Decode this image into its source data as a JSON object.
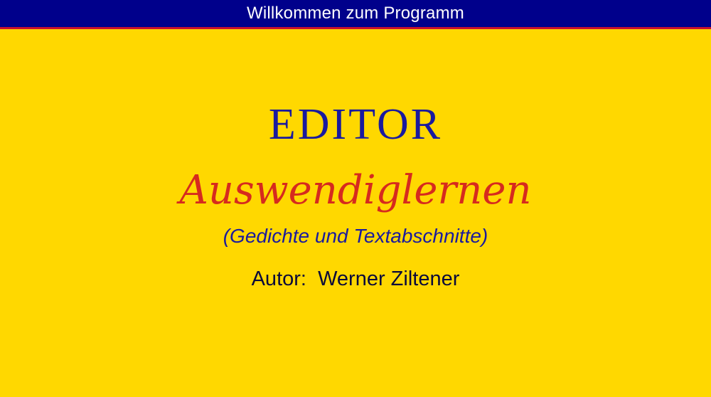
{
  "window": {
    "title": "Willkommen zum Programm"
  },
  "splash": {
    "heading": "EDITOR",
    "subheading": "Auswendiglernen",
    "caption": "(Gedichte und Textabschnitte)",
    "author": "Autor:  Werner Ziltener"
  },
  "colors": {
    "background": "#FFD800",
    "title_bar": "#00008B",
    "title_bar_border": "#C8102E",
    "heading": "#1A1A9E",
    "subheading": "#D62A1E",
    "author": "#0A0A3A"
  }
}
